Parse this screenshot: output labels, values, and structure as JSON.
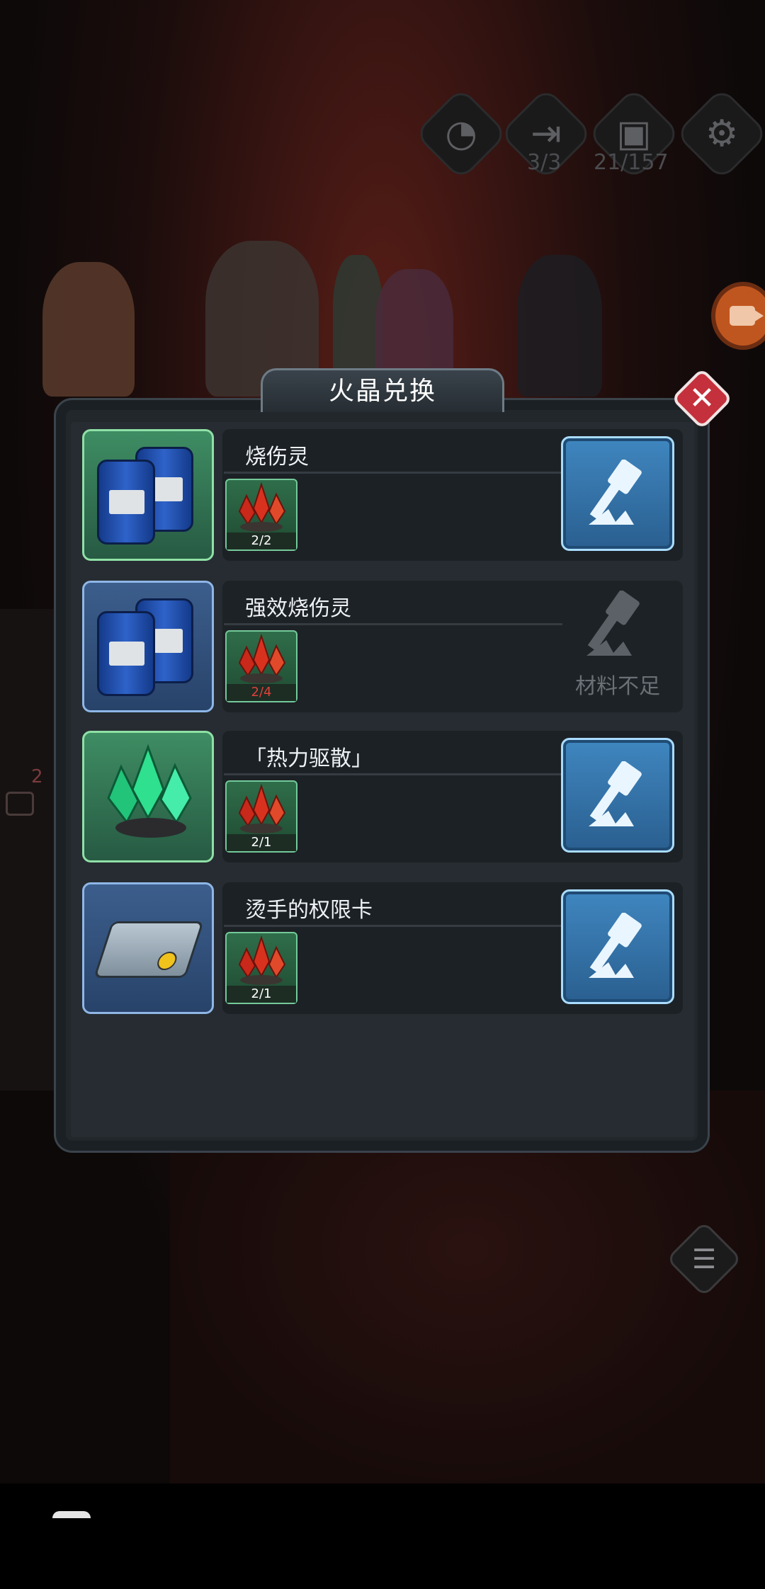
{
  "hud": {
    "door_count": "3/3",
    "chest_count": "21/157",
    "chat_badge": "2"
  },
  "dialog": {
    "title": "火晶兑换",
    "close_label": "✕"
  },
  "items": [
    {
      "name": "烧伤灵",
      "material_count": "2/2",
      "enough": true,
      "thumb": "green",
      "icon": "barrel-icon"
    },
    {
      "name": "强效烧伤灵",
      "material_count": "2/4",
      "enough": false,
      "thumb": "blue",
      "icon": "barrel-icon",
      "status": "材料不足"
    },
    {
      "name": "「热力驱散」",
      "material_count": "2/1",
      "enough": true,
      "thumb": "green",
      "icon": "green-crystal-icon"
    },
    {
      "name": "烫手的权限卡",
      "material_count": "2/1",
      "enough": true,
      "thumb": "blue",
      "icon": "chip-card-icon"
    }
  ],
  "colors": {
    "craft_button": "#2f6fa6",
    "insufficient_count": "#e0403a",
    "close_button": "#c4303b"
  }
}
